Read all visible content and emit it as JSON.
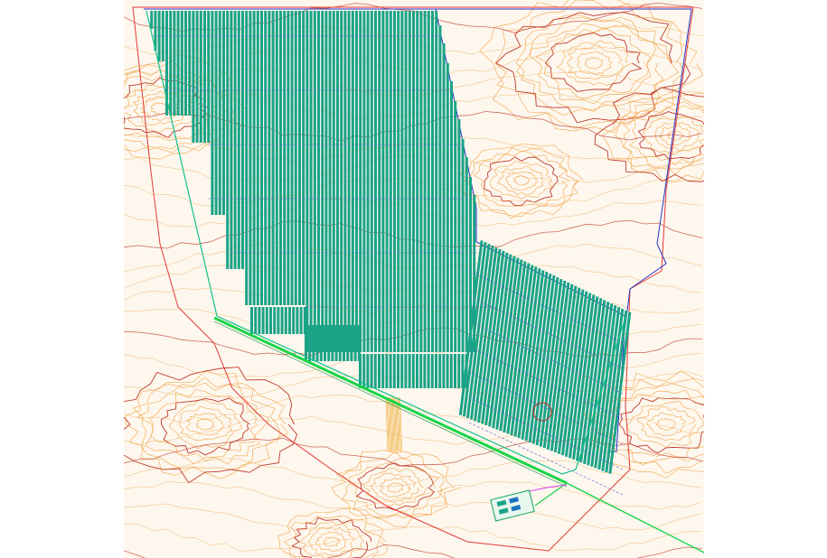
{
  "drawing": {
    "kind": "solar-farm-site-plan",
    "labels": {
      "entrance_label": "",
      "road_label": "",
      "substation_label": ""
    }
  },
  "colors": {
    "background": "#ffffff",
    "paper": "#fdf7ee",
    "contour_minor": "#f2a64a",
    "contour_major": "#c0392b",
    "site_boundary": "#e53935",
    "lease_boundary": "#2433c7",
    "fence_line": "#13c08a",
    "array_fill": "#1aa387",
    "array_gap": "#dff3ee",
    "circuit_line": "#6a5acd",
    "access_road": "#19d447",
    "cable_route": "#e040fb",
    "ground_hatch": "#f0b040",
    "marker": "#c62828"
  },
  "icons": [
    "pv-array-block",
    "substation-block",
    "location-marker"
  ]
}
